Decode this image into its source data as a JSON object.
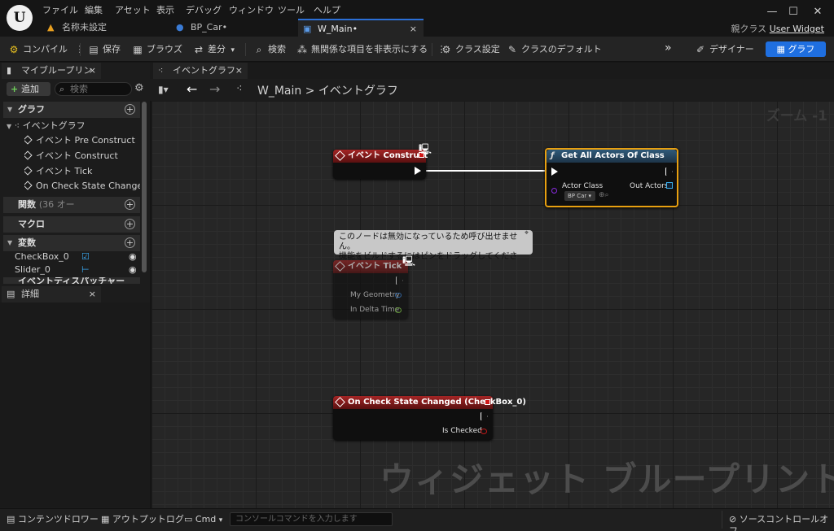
{
  "menu": [
    "ファイル",
    "編集",
    "アセット",
    "表示",
    "デバッグ",
    "ウィンドウ",
    "ツール",
    "ヘルプ"
  ],
  "doc_tabs": [
    {
      "label": "名称未設定"
    },
    {
      "label": "BP_Car•"
    },
    {
      "label": "W_Main•"
    }
  ],
  "parent_class": {
    "prefix": "親クラス",
    "value": "User Widget"
  },
  "toolbar": {
    "compile": "コンパイル",
    "save": "保存",
    "browse": "ブラウズ",
    "diff": "差分",
    "find": "検索",
    "hide_unrelated": "無関係な項目を非表示にする",
    "class_settings": "クラス設定",
    "class_defaults": "クラスのデフォルト",
    "designer": "デザイナー",
    "graph": "グラフ"
  },
  "my_blueprint": {
    "tab": "マイブループリント",
    "add": "追加",
    "search_placeholder": "検索",
    "sections": {
      "graphs": "グラフ",
      "functions": "関数",
      "functions_count": "(36 オー",
      "macros": "マクロ",
      "variables": "変数",
      "dispatchers": "イベントディスパッチャー"
    },
    "event_graph": "イベントグラフ",
    "events": [
      "イベント Pre Construct",
      "イベント Construct",
      "イベント Tick",
      "On Check State Changed (Chec"
    ],
    "variables": [
      "CheckBox_0",
      "Slider_0"
    ]
  },
  "details_tab": "詳細",
  "graph": {
    "tab": "イベントグラフ",
    "breadcrumb_root": "W_Main",
    "breadcrumb_sep": ">",
    "breadcrumb_leaf": "イベントグラフ",
    "zoom": "ズーム -1",
    "watermark": "ウィジェット ブループリント"
  },
  "nodes": {
    "construct": {
      "title": "イベント Construct"
    },
    "get_actors": {
      "title": "Get All Actors Of Class",
      "in_pin": "Actor Class",
      "out_pin": "Out Actors",
      "class_value": "BP Car"
    },
    "tick": {
      "title": "イベント Tick",
      "pin1": "My Geometry",
      "pin2": "In Delta Time"
    },
    "check": {
      "title": "On Check State Changed (CheckBox_0)",
      "pin": "Is Checked"
    }
  },
  "tooltip": {
    "line1": "このノードは無効になっているため呼び出せません。",
    "line2": "機能をビルドするにはピンをドラッグしてください。"
  },
  "status_bar": {
    "content_drawer": "コンテンツドロワー",
    "output_log": "アウトプットログ",
    "cmd": "Cmd",
    "console_placeholder": "コンソールコマンドを入力します",
    "source_control": "ソースコントロールオフ"
  }
}
